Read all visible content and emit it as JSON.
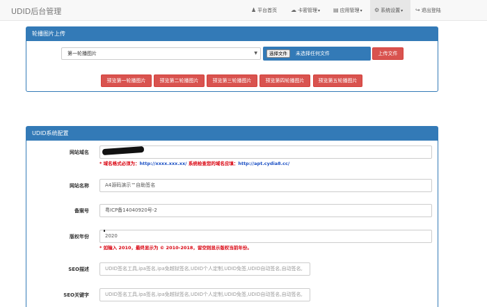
{
  "navbar": {
    "brand": "UDID后台管理",
    "items": [
      {
        "label": "平台首页",
        "icon": "user-icon"
      },
      {
        "label": "卡密管理",
        "icon": "cloud-icon"
      },
      {
        "label": "应用管理",
        "icon": "file-icon"
      },
      {
        "label": "系统设置",
        "icon": "gear-icon",
        "active": true
      },
      {
        "label": "退出登陆",
        "icon": "logout-icon"
      }
    ]
  },
  "carousel_panel": {
    "title": "轮播图片上传",
    "select_value": "第一轮播图片",
    "file_button": "选择文件",
    "file_status": "未选择任何文件",
    "upload_button": "上传文件",
    "preview_buttons": [
      "预览第一轮播图片",
      "预览第二轮播图片",
      "预览第三轮播图片",
      "预览第四轮播图片",
      "预览第五轮播图片"
    ]
  },
  "config_panel": {
    "title": "UDID系统配置",
    "domain_label": "网站域名",
    "domain_hint_prefix": "* 域名格式必须为：",
    "domain_hint_example1": "http://xxxx.xxx.xx/",
    "domain_hint_middle": " 系统检查您的域名应填：",
    "domain_hint_example2": "http://apt.cydia8.cc/",
    "name_label": "网站名称",
    "name_value": "A4源码演示™自助签名",
    "icp_label": "备案号",
    "icp_value": "粤ICP备14040920号-2",
    "year_label": "版权年份",
    "year_value": "2020",
    "year_hint": "* 如输入 2010，最终显示为 © 2010-2018，留空则显示版权当前年份。",
    "seo_desc_label": "SEO描述",
    "seo_desc_placeholder": "UDID签名工具,ipa签名,ipa免越狱签名,UDID个人定制,UDID免签,UDID自动签名,自动签名,",
    "seo_kw_label": "SEO关键字",
    "seo_kw_placeholder": "UDID签名工具,ipa签名,ipa免越狱签名,UDID个人定制,UDID免签,UDID自动签名,自动签名,"
  },
  "colors": {
    "primary": "#337ab7",
    "danger": "#d9534f",
    "hint_red": "#d9000d",
    "hint_blue": "#1a4fc4"
  }
}
